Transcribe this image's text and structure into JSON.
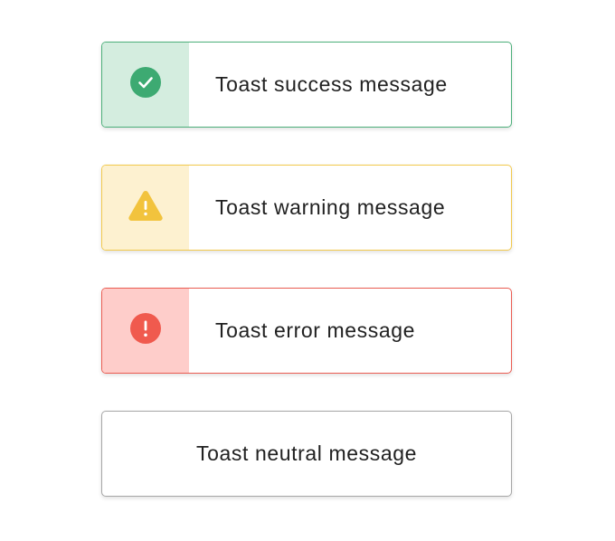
{
  "toasts": {
    "success": {
      "message": "Toast success message",
      "icon": "check-circle-icon",
      "border_color": "#4CAF7A",
      "icon_bg": "#D4EDDF",
      "icon_color": "#3DAA72"
    },
    "warning": {
      "message": "Toast warning message",
      "icon": "warning-triangle-icon",
      "border_color": "#F2C94C",
      "icon_bg": "#FDF1D0",
      "icon_color": "#F2C33D"
    },
    "error": {
      "message": "Toast error message",
      "icon": "error-circle-icon",
      "border_color": "#EB5C52",
      "icon_bg": "#FECDCA",
      "icon_color": "#F05A4E"
    },
    "neutral": {
      "message": "Toast neutral message",
      "border_color": "#A6A6A6"
    }
  }
}
